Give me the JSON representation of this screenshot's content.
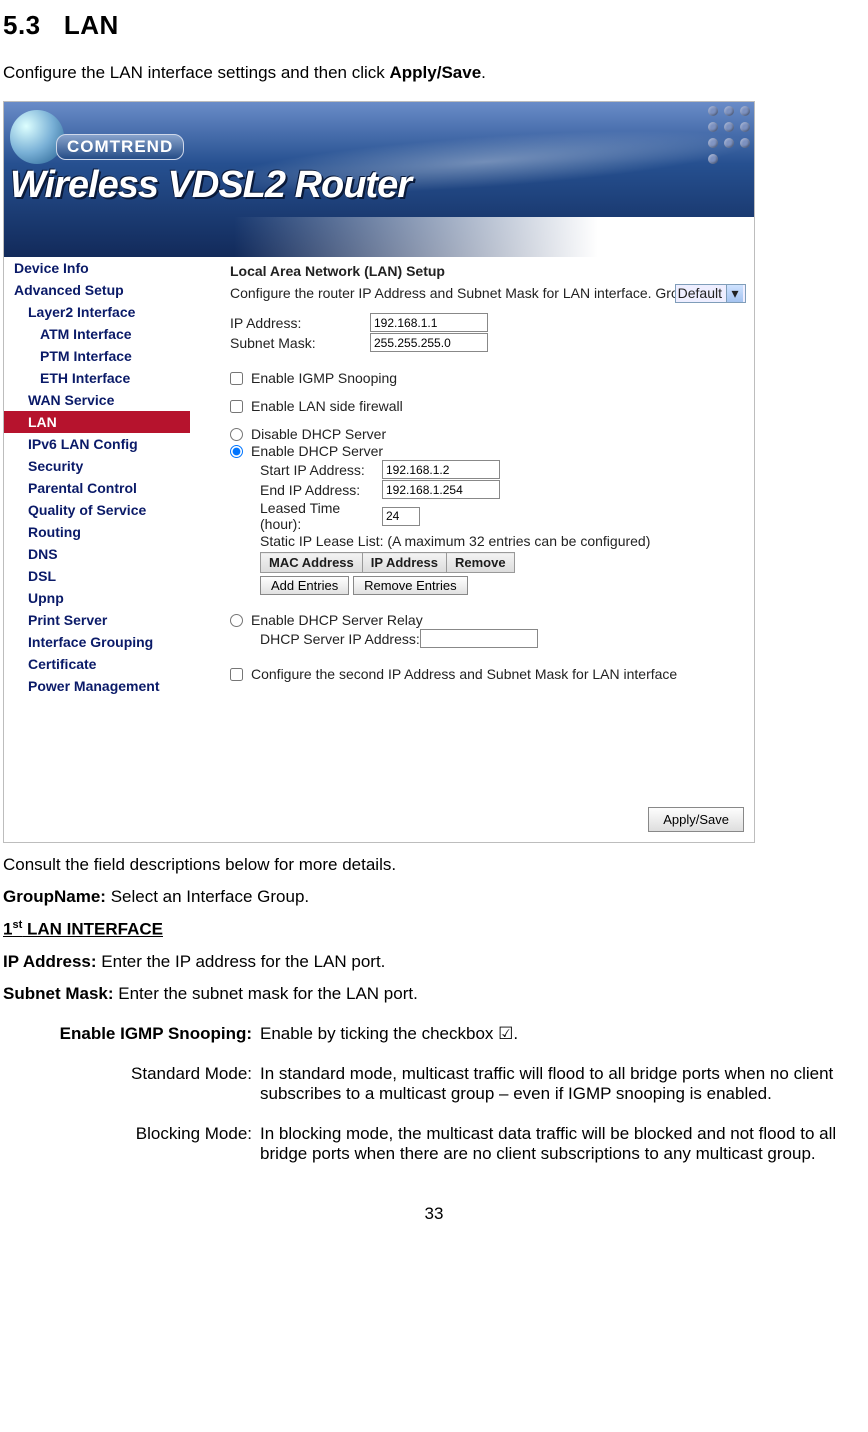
{
  "heading": {
    "number": "5.3",
    "title": "LAN"
  },
  "intro_a": "Configure the LAN interface settings and then click ",
  "intro_b": "Apply/Save",
  "intro_c": ".",
  "brand": {
    "name": "COMTREND",
    "product": "Wireless VDSL2 Router"
  },
  "nav": {
    "i0": "Device Info",
    "i1": "Advanced Setup",
    "i2": "Layer2 Interface",
    "i3": "ATM Interface",
    "i4": "PTM Interface",
    "i5": "ETH Interface",
    "i6": "WAN Service",
    "i7": "LAN",
    "i8": "IPv6 LAN Config",
    "i9": "Security",
    "i10": "Parental Control",
    "i11": "Quality of Service",
    "i12": "Routing",
    "i13": "DNS",
    "i14": "DSL",
    "i15": "Upnp",
    "i16": "Print Server",
    "i17": "Interface Grouping",
    "i18": "Certificate",
    "i19": "Power Management"
  },
  "pane": {
    "title": "Local Area Network (LAN) Setup",
    "desc_a": "Configure the router IP Address and Subnet Mask for LAN interface.  GroupName",
    "group_select": "Default",
    "ip_label": "IP Address:",
    "ip_value": "192.168.1.1",
    "sm_label": "Subnet Mask:",
    "sm_value": "255.255.255.0",
    "igmp": "Enable IGMP Snooping",
    "fw": "Enable LAN side firewall",
    "dhcp_off": "Disable DHCP Server",
    "dhcp_on": "Enable DHCP Server",
    "start_l": "Start IP Address:",
    "start_v": "192.168.1.2",
    "end_l": "End IP Address:",
    "end_v": "192.168.1.254",
    "lease_l": "Leased Time (hour):",
    "lease_v": "24",
    "static_caption": "Static IP Lease List: (A maximum 32 entries can be configured)",
    "th_mac": "MAC Address",
    "th_ip": "IP Address",
    "th_rm": "Remove",
    "btn_add": "Add Entries",
    "btn_rm": "Remove Entries",
    "relay": "Enable DHCP Server Relay",
    "relay_ip": "DHCP Server IP Address:",
    "second": "Configure the second IP Address and Subnet Mask for LAN interface",
    "apply": "Apply/Save"
  },
  "below": {
    "consult": "Consult the field descriptions below for more details.",
    "gname_k": "GroupName:",
    "gname_v": " Select an Interface Group.",
    "first_if": "1",
    "first_if_sup": "st",
    "first_if_rest": " LAN INTERFACE",
    "ip_k": "IP Address:",
    "ip_v": " Enter the IP address for the LAN port.",
    "sm_k": "Subnet Mask:",
    "sm_v": " Enter the subnet mask for the LAN port.",
    "igmp_k": "Enable IGMP Snooping:",
    "igmp_v": "Enable by ticking the checkbox ☑.",
    "std_k": "Standard Mode:",
    "std_v": "In standard mode, multicast traffic will flood to all bridge ports when no client subscribes to a multicast group – even if IGMP snooping is enabled.",
    "blk_k": "Blocking Mode:",
    "blk_v": "In blocking mode, the multicast data traffic will be blocked and not flood to all bridge ports when there are no client subscriptions to any multicast group."
  },
  "page": "33"
}
